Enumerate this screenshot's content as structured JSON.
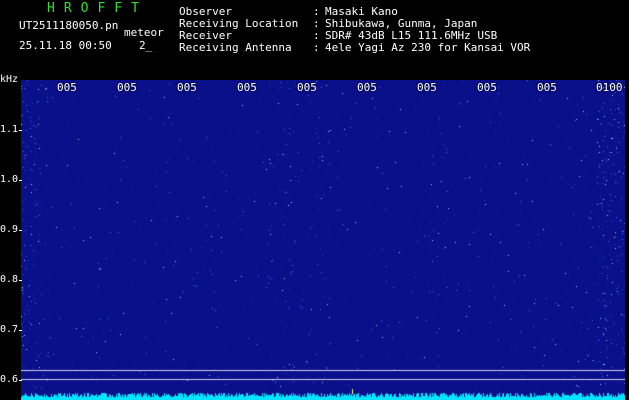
{
  "header": {
    "app_title": "HROFFT",
    "file_name": "UT2511180050.pn",
    "tag": "meteor",
    "datetime": "25.11.18 00:50",
    "count": "2_"
  },
  "info": [
    {
      "key": "Observer",
      "value": "Masaki Kano"
    },
    {
      "key": "Receiving Location",
      "value": "Shibukawa, Gunma, Japan"
    },
    {
      "key": "Receiver",
      "value": "SDR# 43dB L15 111.6MHz USB"
    },
    {
      "key": "Receiving Antenna",
      "value": "4ele Yagi Az 230 for Kansai VOR"
    }
  ],
  "separator": ":",
  "spectrogram": {
    "y_unit": "kHz",
    "y_ticks": [
      "1.1",
      "1.0",
      "0.9",
      "0.8",
      "0.7",
      "0.6"
    ],
    "x_ticks": [
      "005",
      "005",
      "005",
      "005",
      "005",
      "005",
      "005",
      "005",
      "005",
      "0100"
    ],
    "colors": {
      "background": "#0a0f8a",
      "noise": "#3a6cff",
      "baseline": "#00e5ff",
      "marker_line": "#ffffff",
      "tick_text": "#ffffff"
    }
  }
}
